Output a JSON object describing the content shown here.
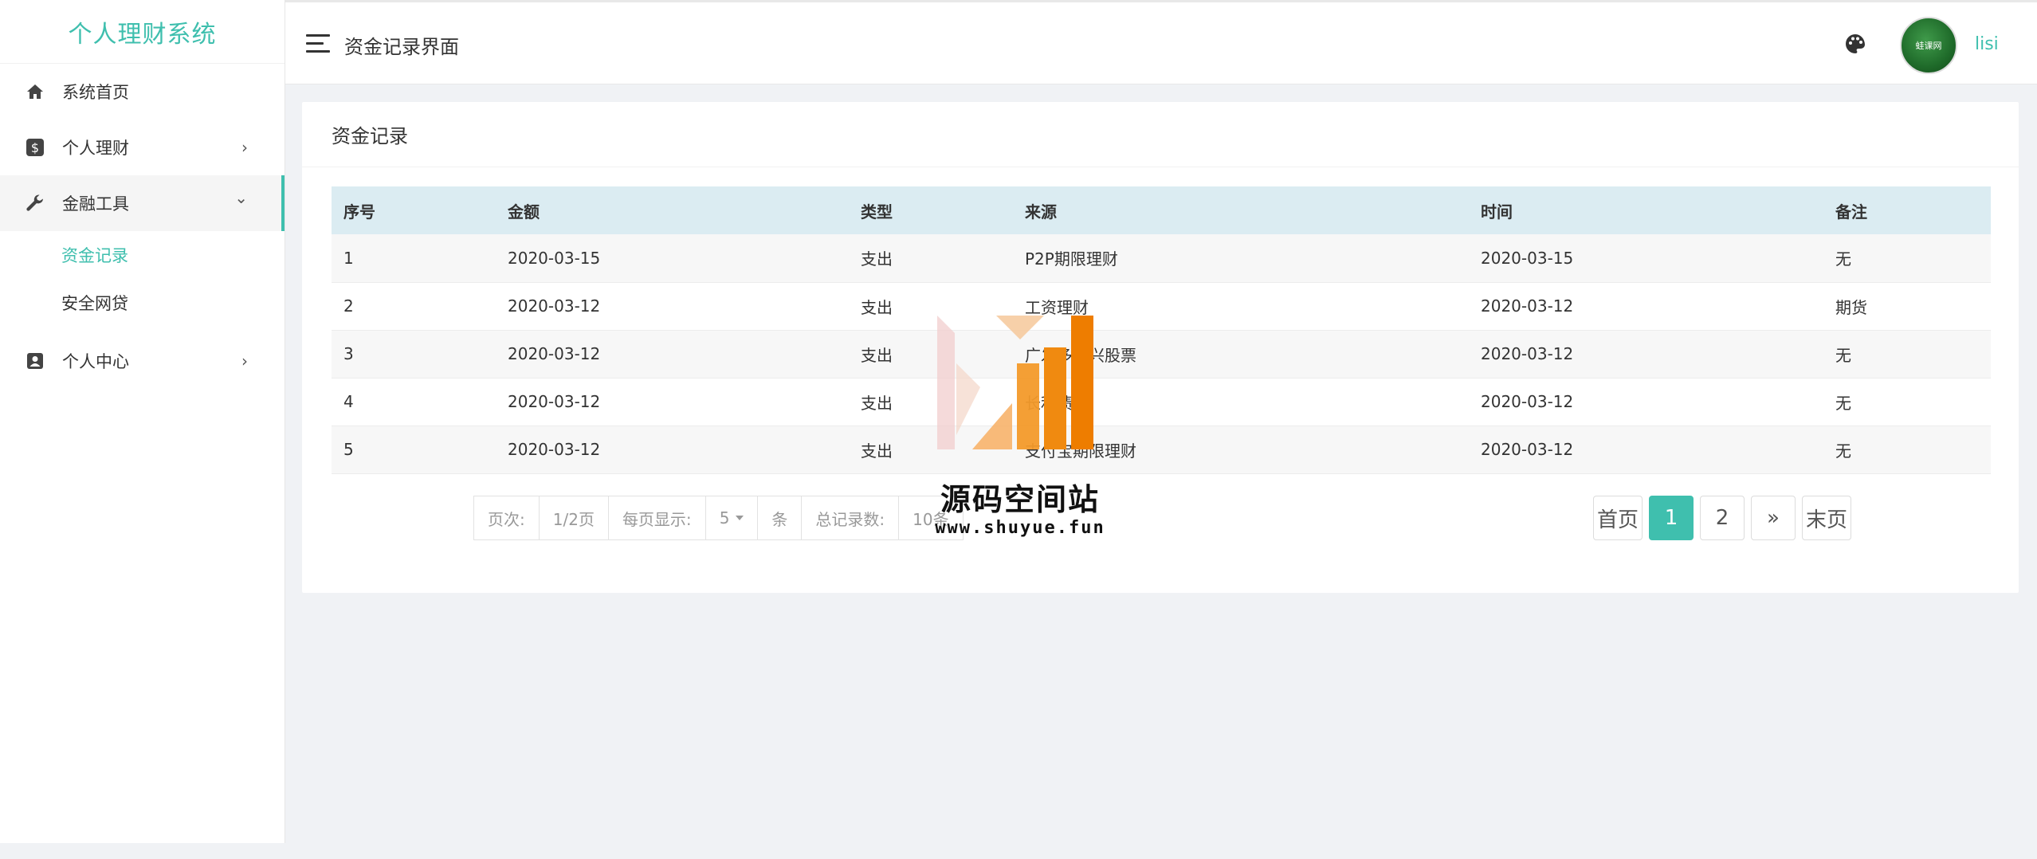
{
  "sidebar": {
    "brand": "个人理财系统",
    "items": [
      {
        "label": "系统首页"
      },
      {
        "label": "个人理财",
        "arrow": "›"
      },
      {
        "label": "金融工具",
        "arrow": "⌄"
      },
      {
        "label": "个人中心",
        "arrow": "›"
      }
    ],
    "submenu": [
      {
        "label": "资金记录"
      },
      {
        "label": "安全网贷"
      }
    ]
  },
  "header": {
    "title": "资金记录界面",
    "username": "lisi",
    "avatar_text": "蛙课网"
  },
  "card": {
    "title": "资金记录"
  },
  "table": {
    "headers": [
      "序号",
      "金额",
      "类型",
      "来源",
      "时间",
      "备注"
    ],
    "rows": [
      [
        "1",
        "2020-03-15",
        "支出",
        "P2P期限理财",
        "2020-03-15",
        "无"
      ],
      [
        "2",
        "2020-03-12",
        "支出",
        "工资理财",
        "2020-03-12",
        "期货"
      ],
      [
        "3",
        "2020-03-12",
        "支出",
        "广发多新兴股票",
        "2020-03-12",
        "无"
      ],
      [
        "4",
        "2020-03-12",
        "支出",
        "长利债券",
        "2020-03-12",
        "无"
      ],
      [
        "5",
        "2020-03-12",
        "支出",
        "支付宝期限理财",
        "2020-03-12",
        "无"
      ]
    ]
  },
  "pager": {
    "page_label": "页次:",
    "page_value": "1/2页",
    "per_page_label": "每页显示:",
    "per_page_value": "5",
    "per_page_unit": "条",
    "total_label": "总记录数:",
    "total_value": "10条"
  },
  "pagination": {
    "first": "首页",
    "pages": [
      "1",
      "2"
    ],
    "next": "»",
    "last": "末页"
  },
  "watermark": {
    "text": "源码空间站",
    "url": "www.shuyue.fun"
  },
  "colors": {
    "accent": "#3fbfae",
    "table_header": "#dbecf2"
  }
}
